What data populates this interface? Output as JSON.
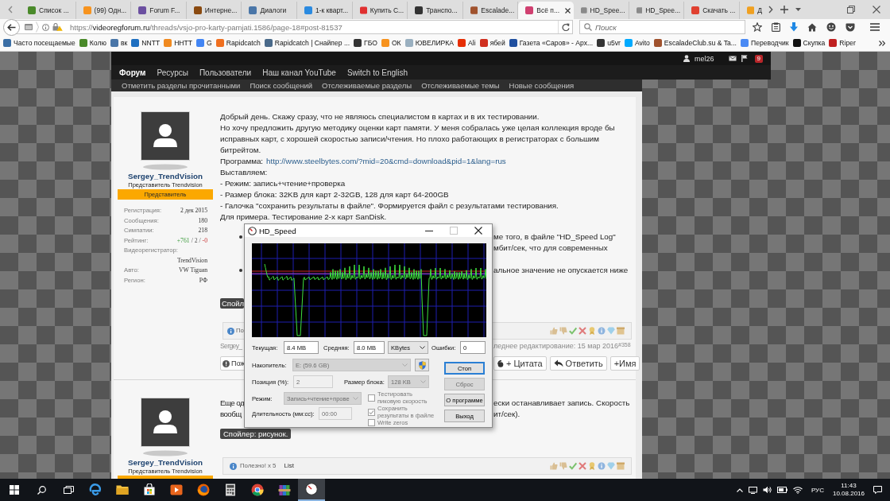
{
  "browser": {
    "tabs": [
      {
        "title": "Список ...",
        "color": "#4a8a2a",
        "selected": false
      },
      {
        "title": "(99) Одн...",
        "color": "#f7931e",
        "selected": false
      },
      {
        "title": "Forum F...",
        "color": "#6b4fa0",
        "selected": false
      },
      {
        "title": "Интерне...",
        "color": "#8a4a10",
        "selected": false
      },
      {
        "title": "Диалоги",
        "color": "#4a76a8",
        "selected": false
      },
      {
        "title": "1-к кварт...",
        "color": "#2a8ae0",
        "selected": false
      },
      {
        "title": "Купить С...",
        "color": "#e03030",
        "selected": false
      },
      {
        "title": "Транспо...",
        "color": "#333333",
        "selected": false
      },
      {
        "title": "Escalade...",
        "color": "#a0522d",
        "selected": false
      },
      {
        "title": "Всё п...",
        "color": "#d04070",
        "selected": true
      },
      {
        "title": "HD_Spee...",
        "color": "#8a8a8a",
        "selected": false
      },
      {
        "title": "HD_Spee...",
        "color": "#8a8a8a",
        "selected": false
      },
      {
        "title": "Скачать ...",
        "color": "#e04030",
        "selected": false
      },
      {
        "title": "Д",
        "color": "#f0a020",
        "selected": false
      }
    ],
    "address": {
      "scheme": "https://",
      "host": "videoregforum.ru",
      "path": "/threads/vsjo-pro-karty-pamjati.1586/page-18#post-81537"
    },
    "search": {
      "placeholder": "Поиск"
    },
    "bookmarks": [
      {
        "label": "Часто посещаемые",
        "color": "#3a6ea5"
      },
      {
        "label": "Колю",
        "color": "#4a8a2a"
      },
      {
        "label": "вк",
        "color": "#4a76a8"
      },
      {
        "label": "NNTT",
        "color": "#1e6fc0"
      },
      {
        "label": "HHTT",
        "color": "#f08a20"
      },
      {
        "label": "G",
        "color": "#4285f4"
      },
      {
        "label": "Rapidcatch",
        "color": "#f07020"
      },
      {
        "label": "Rapidcatch | Снайпер ...",
        "color": "#4a6a8a"
      },
      {
        "label": "ГБО",
        "color": "#333333"
      },
      {
        "label": "ОК",
        "color": "#f7931e"
      },
      {
        "label": "ЮВЕЛИРКА",
        "color": "#9ab0c0"
      },
      {
        "label": "Ali",
        "color": "#e62e04"
      },
      {
        "label": "ябей",
        "color": "#d03020"
      },
      {
        "label": "Газета «Саров» - Арх...",
        "color": "#2050a0"
      },
      {
        "label": "u5vr",
        "color": "#333333"
      },
      {
        "label": "Avito",
        "color": "#00aaff"
      },
      {
        "label": "EscaladeClub.su & Ta...",
        "color": "#a0522d"
      },
      {
        "label": "Переводчик",
        "color": "#4a8af4"
      },
      {
        "label": "Скупка",
        "color": "#111111"
      },
      {
        "label": "Riper",
        "color": "#c02020"
      }
    ]
  },
  "forum": {
    "user_bar": {
      "username": "mel26",
      "alerts": "9"
    },
    "nav": [
      {
        "label": "Форум",
        "selected": true
      },
      {
        "label": "Ресурсы",
        "selected": false
      },
      {
        "label": "Пользователи",
        "selected": false
      },
      {
        "label": "Наш канал YouTube",
        "selected": false
      },
      {
        "label": "Switch to English",
        "selected": false
      }
    ],
    "subnav": [
      "Отметить разделы прочитанными",
      "Поиск сообщений",
      "Отслеживаемые разделы",
      "Отслеживаемые темы",
      "Новые сообщения"
    ],
    "posts": [
      {
        "author": {
          "name": "Sergey_TrendVision",
          "title": "Представитель Trendvision",
          "rank": "Представитель",
          "stats": [
            {
              "kind": "text",
              "label": "Регистрация:",
              "value": "2 дек 2015"
            },
            {
              "kind": "text",
              "label": "Сообщения:",
              "value": "180"
            },
            {
              "kind": "text",
              "label": "Симпатии:",
              "value": "218"
            },
            {
              "kind": "rating",
              "label": "Рейтинг:",
              "parts": [
                {
                  "kind": "positive",
                  "text": "+761"
                },
                {
                  "kind": "neutral",
                  "text": "/ 2 /"
                },
                {
                  "kind": "negative",
                  "text": "-0"
                }
              ]
            },
            {
              "kind": "text",
              "label": "Видеорегистратор:",
              "value": "TrendVision"
            },
            {
              "kind": "text",
              "label": "Авто:",
              "value": "VW Tiguan"
            },
            {
              "kind": "text",
              "label": "Регион:",
              "value": "РФ"
            }
          ]
        },
        "paragraphs": [
          {
            "kind": "text",
            "text": "Добрый день. Скажу сразу, что не являюсь специалистом в картах и в их тестировании."
          },
          {
            "kind": "text",
            "text": "Но хочу предложить другую методику оценки карт памяти. У меня собралась уже целая коллекция вроде бы исправных карт, с хорошей скоростью записи/чтения. Но плохо работающих в регистраторах с большим битрейтом."
          },
          {
            "kind": "link",
            "text": "Программа:",
            "link": "http://www.steelbytes.com/?mid=20&cmd=download&pid=1&lang=rus"
          },
          {
            "kind": "text",
            "text": "Выставляем:"
          },
          {
            "kind": "text",
            "text": "- Режим: запись+чтение+проверка"
          },
          {
            "kind": "text",
            "text": "- Размер блока: 32KB для карт 2-32GB, 128 для карт 64-200GB"
          },
          {
            "kind": "text",
            "text": "- Галочка \"сохранить результаты в файле\". Формируется файл с результатами тестирования."
          },
          {
            "kind": "text",
            "text": "Для примера. Тестирование 2-х карт SanDisk."
          }
        ],
        "bullets": [
          {
            "lines": [
              "ме того, в файле \"HD_Speed Log\"",
              "мбит/сек, что для современных"
            ]
          },
          {
            "lines": [
              "альное значение не опускается ниже"
            ]
          }
        ],
        "spoiler": "Спойл",
        "footer": {
          "text": "По"
        },
        "meta": {
          "author": "Sergey_",
          "edited": "леднее редактирование: 15 мар 2016",
          "number": "#358"
        },
        "actions": [
          {
            "kind": "report",
            "label": "Пож"
          },
          {
            "kind": "quote",
            "label": "+ Цитата"
          },
          {
            "kind": "reply",
            "label": "Ответить"
          },
          {
            "kind": "mention",
            "label": "+Имя"
          }
        ]
      },
      {
        "author": {
          "name": "Sergey_TrendVision",
          "title": "Представитель Trendvision"
        },
        "split_lines": [
          {
            "left": "Еще од",
            "right": "ески останавливает запись. Скорость"
          },
          {
            "left": "вообщ",
            "right": "ит/сек)."
          }
        ],
        "spoiler": "Спойлер: рисунок.",
        "footer": {
          "text": "Полезно! x 5",
          "link": "List"
        }
      }
    ]
  },
  "hd_speed": {
    "title": "HD_Speed",
    "title_buttons": [
      {
        "kind": "minimize",
        "disabled": false
      },
      {
        "kind": "maximize",
        "disabled": true
      },
      {
        "kind": "close",
        "disabled": false
      }
    ],
    "readouts": [
      {
        "label": "Текущая:",
        "value": "8.4 MB"
      },
      {
        "label": "Средняя:",
        "value": "8.0 MB"
      },
      {
        "label": "Ошибки:",
        "value": "0"
      }
    ],
    "unit": {
      "value": "KBytes",
      "disabled": false
    },
    "drive": {
      "label": "Накопитель:",
      "value": "E: (59.6 GB)",
      "disabled": true
    },
    "position": {
      "label": "Позиция (%):",
      "value": "2",
      "disabled": true
    },
    "block_size": {
      "label": "Размер блока:",
      "value": "128 KB",
      "disabled": true
    },
    "mode": {
      "label": "Режим:",
      "value": "Запись+чтение+прове",
      "disabled": true
    },
    "duration": {
      "label": "Длительность (мм:сс):",
      "value": "00:00",
      "disabled": true
    },
    "checkboxes": [
      {
        "label": "Тестировать пиковую скорость",
        "checked": false,
        "disabled": true
      },
      {
        "label": "Сохранить результаты в файле",
        "checked": true,
        "disabled": true
      },
      {
        "label": "Write zeros",
        "checked": false,
        "disabled": true
      }
    ],
    "buttons": [
      {
        "label": "Стоп",
        "default": true,
        "disabled": false
      },
      {
        "label": "Сброс",
        "default": false,
        "disabled": true
      },
      {
        "label": "О программе",
        "default": false,
        "disabled": false
      },
      {
        "label": "Выход",
        "default": false,
        "disabled": false
      }
    ]
  },
  "taskbar": {
    "apps": [
      {
        "kind": "edge",
        "selected": false
      },
      {
        "kind": "explorer",
        "selected": false
      },
      {
        "kind": "store",
        "selected": false
      },
      {
        "kind": "media",
        "selected": false
      },
      {
        "kind": "firefox",
        "selected": false
      },
      {
        "kind": "calculator",
        "selected": false
      },
      {
        "kind": "chrome",
        "selected": false
      },
      {
        "kind": "archiver",
        "selected": false
      },
      {
        "kind": "gauge",
        "selected": true
      }
    ],
    "tray": {
      "language": "РУС",
      "time": "11:43",
      "date": "10.08.2016"
    }
  }
}
